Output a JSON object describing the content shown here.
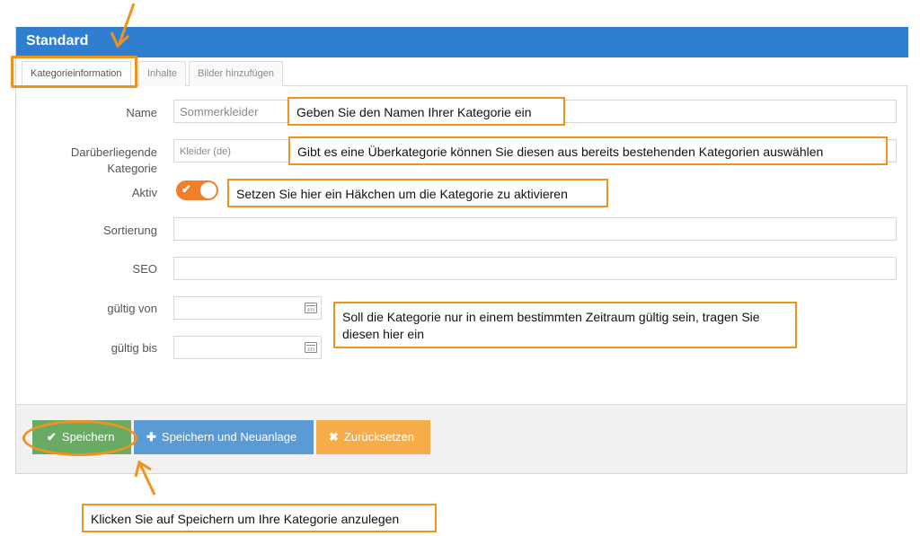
{
  "panel": {
    "title": "Standard"
  },
  "tabs": [
    {
      "label": "Kategorieinformation"
    },
    {
      "label": "Inhalte"
    },
    {
      "label": "Bilder hinzufügen"
    }
  ],
  "form": {
    "name_label": "Name",
    "name_value": "Sommerkleider",
    "parent_label_line1": "Darüberliegende",
    "parent_label_line2": "Kategorie",
    "parent_value": "Kleider (de)",
    "active_label": "Aktiv",
    "sort_label": "Sortierung",
    "seo_label": "SEO",
    "valid_from_label": "gültig von",
    "valid_to_label": "gültig bis"
  },
  "buttons": {
    "save": "Speichern",
    "save_new": "Speichern und Neuanlage",
    "reset": "Zurücksetzen"
  },
  "callouts": {
    "name": "Geben Sie den Namen Ihrer Kategorie ein",
    "parent": "Gibt es eine Überkategorie können Sie diesen aus bereits bestehenden Kategorien auswählen",
    "active": "Setzen Sie hier ein Häkchen um die Kategorie zu aktivieren",
    "validity": "Soll die Kategorie nur in einem bestimmten Zeitraum gültig sein, tragen Sie diesen hier ein",
    "save": "Klicken Sie auf Speichern um Ihre Kategorie anzulegen"
  },
  "colors": {
    "header": "#2f7fd1",
    "accent": "#f0931e",
    "toggle": "#f07e2b",
    "save": "#6aab63",
    "save_new": "#5b9bd5",
    "reset": "#f7ac4a"
  },
  "icons": [
    "check-icon",
    "plus-icon",
    "x-icon",
    "calendar-icon",
    "arrow-icon"
  ]
}
